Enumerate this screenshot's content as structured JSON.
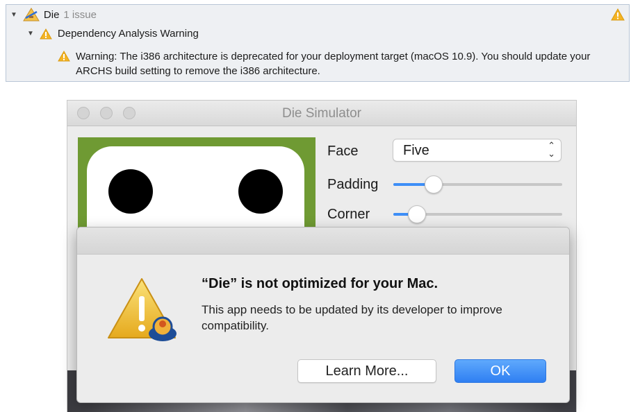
{
  "issue_navigator": {
    "project": {
      "name": "Die",
      "issue_count": "1 issue",
      "icon": "xcode-project-icon"
    },
    "group": {
      "title": "Dependency Analysis Warning",
      "icon": "warning-icon"
    },
    "warning": {
      "icon": "warning-icon",
      "message": "Warning: The i386 architecture is deprecated for your deployment target (macOS 10.9). You should update your ARCHS build setting to remove the i386 architecture."
    }
  },
  "simulator_window": {
    "title": "Die Simulator",
    "controls": {
      "face_label": "Face",
      "face_value": "Five",
      "padding_label": "Padding",
      "padding_value": 0.24,
      "corner_label": "Corner",
      "corner_value": 0.14
    },
    "colors": {
      "die_background": "#6f9a33",
      "accent": "#3d8ef7"
    }
  },
  "alert": {
    "title": "“Die” is not optimized for your Mac.",
    "message": "This app needs to be updated by its developer to improve compatibility.",
    "learn_more_label": "Learn More...",
    "ok_label": "OK",
    "icon": "caution-icon"
  }
}
